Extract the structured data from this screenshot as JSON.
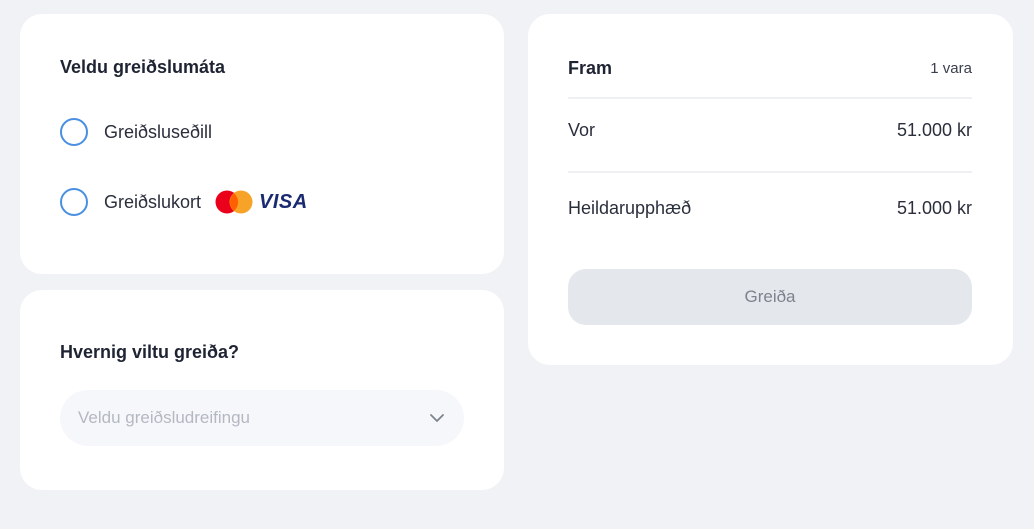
{
  "payment_method": {
    "title": "Veldu greiðslumáta",
    "options": [
      {
        "label": "Greiðsluseðill",
        "selected": false
      },
      {
        "label": "Greiðslukort",
        "selected": false,
        "brands": [
          "mastercard-icon",
          "visa-icon"
        ],
        "visa_text": "VISA"
      }
    ]
  },
  "installments": {
    "title": "Hvernig viltu greiða?",
    "select_placeholder": "Veldu greiðsludreifingu"
  },
  "summary": {
    "head_label": "Fram",
    "head_count": "1 vara",
    "item_label": "Vor",
    "item_value": "51.000 kr",
    "total_label": "Heildarupphæð",
    "total_value": "51.000 kr",
    "pay_label": "Greiða"
  },
  "colors": {
    "background": "#f1f2f6",
    "radio_border": "#4a90e2",
    "button_bg": "#e4e7ec",
    "visa_blue": "#1a2a71",
    "mastercard_red": "#eb001b",
    "mastercard_orange": "#f79e1b"
  }
}
